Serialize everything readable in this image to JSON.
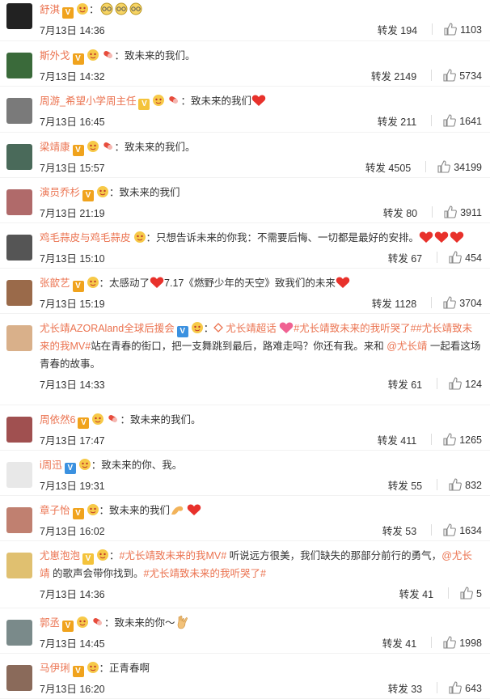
{
  "labels": {
    "repost": "转发"
  },
  "comments": [
    {
      "user": "舒淇",
      "colon": "：",
      "text": "",
      "date": "7月13日 14:36",
      "repost": "194",
      "likes": "1103",
      "badges": [
        "v-orange",
        "face"
      ],
      "extra": "glasses3",
      "av": "#222"
    },
    {
      "user": "斯外戈",
      "colon": "：",
      "text": "致未来的我们。",
      "date": "7月13日 14:32",
      "repost": "2149",
      "likes": "5734",
      "badges": [
        "v-orange",
        "face",
        "tag"
      ],
      "av": "#3a6a3a"
    },
    {
      "user": "周游_希望小学周主任",
      "colon": "：",
      "text": "致未来的我们",
      "date": "7月13日 16:45",
      "repost": "211",
      "likes": "1641",
      "badges": [
        "v-gold",
        "face",
        "tag"
      ],
      "suffix": "heart1",
      "av": "#7a7a7a"
    },
    {
      "user": "梁靖康",
      "colon": "：",
      "text": "致未来的我们。",
      "date": "7月13日 15:57",
      "repost": "4505",
      "likes": "34199",
      "badges": [
        "v-orange",
        "face",
        "tag"
      ],
      "av": "#4a6a5a"
    },
    {
      "user": "演员乔杉",
      "colon": "：",
      "text": "致未来的我们",
      "date": "7月13日 21:19",
      "repost": "80",
      "likes": "3911",
      "badges": [
        "v-orange",
        "face"
      ],
      "av": "#b06a6a"
    },
    {
      "user": "鸡毛蒜皮与鸡毛蒜皮",
      "colon": "：",
      "text": "只想告诉未来的你我：不需要后悔、一切都是最好的安排。",
      "date": "7月13日 15:10",
      "repost": "67",
      "likes": "454",
      "badges": [
        "face"
      ],
      "suffix": "heart3",
      "av": "#555"
    },
    {
      "user": "张歆艺",
      "colon": "：",
      "text": "太感动了",
      "text2": "7.17《燃野少年的天空》致我们的未来",
      "date": "7月13日 15:19",
      "repost": "1128",
      "likes": "3704",
      "badges": [
        "v-orange",
        "face"
      ],
      "mid": "heart1",
      "suffix": "heart1",
      "av": "#9a6a4a"
    },
    {
      "user": "尤长靖AZORAland全球后援会",
      "colon": "：",
      "topic1": "尤长靖超话",
      "topic2": "#尤长靖致未来的我听哭了#",
      "topic3": "#尤长靖致未来的我MV#",
      "text": "站在青春的街口，把一支舞跳到最后，路难走吗？你还有我。来和",
      "mention": "@尤长靖",
      "text3": "一起看这场青春的故事。",
      "date": "7月13日 14:33",
      "repost": "61",
      "likes": "124",
      "badges": [
        "v-blue",
        "face"
      ],
      "av": "#d9b08a"
    },
    {
      "user": "周依然6",
      "colon": "：",
      "text": "致未来的我们。",
      "date": "7月13日 17:47",
      "repost": "411",
      "likes": "1265",
      "badges": [
        "v-orange",
        "face",
        "tag"
      ],
      "av": "#a05050"
    },
    {
      "user": "i周迅",
      "colon": "：",
      "text": "致未来的你、我。",
      "date": "7月13日 19:31",
      "repost": "55",
      "likes": "832",
      "badges": [
        "v-blue",
        "face"
      ],
      "av": "#e8e8e8"
    },
    {
      "user": "章子怡",
      "colon": "：",
      "text": "致未来的我们",
      "date": "7月13日 16:02",
      "repost": "53",
      "likes": "1634",
      "badges": [
        "v-orange",
        "face"
      ],
      "suffix": "arm-heart",
      "av": "#c08070"
    },
    {
      "user": "尤崽泡泡",
      "colon": "：",
      "topic1": "#尤长靖致未来的我MV#",
      "text": "听说远方很美，我们缺失的那部分前行的勇气，",
      "mention": "@尤长靖",
      "text3": "的歌声会带你找到。",
      "topic2": "#尤长靖致未来的我听哭了#",
      "date": "7月13日 14:36",
      "repost": "41",
      "likes": "5",
      "badges": [
        "v-gold",
        "face"
      ],
      "av": "#e0c070"
    },
    {
      "user": "郭丞",
      "colon": "：",
      "text": "致未来的你～",
      "date": "7月13日 14:45",
      "repost": "41",
      "likes": "1998",
      "badges": [
        "v-orange",
        "face",
        "tag"
      ],
      "suffix": "hand",
      "av": "#7a8a8a"
    },
    {
      "user": "马伊琍",
      "colon": "：",
      "text": "正青春啊",
      "date": "7月13日 16:20",
      "repost": "33",
      "likes": "643",
      "badges": [
        "v-orange",
        "face"
      ],
      "av": "#8a6a5a"
    }
  ]
}
